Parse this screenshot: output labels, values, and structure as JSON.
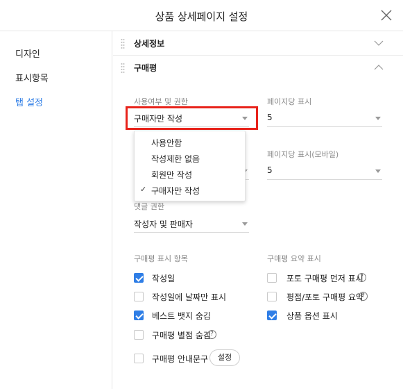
{
  "dialog": {
    "title": "상품 상세페이지 설정"
  },
  "sidebar": {
    "items": [
      {
        "label": "디자인",
        "active": false
      },
      {
        "label": "표시항목",
        "active": false
      },
      {
        "label": "탭 설정",
        "active": true
      }
    ]
  },
  "sections": {
    "detail": {
      "title": "상세정보"
    },
    "review": {
      "title": "구매평"
    }
  },
  "review_settings": {
    "usage_label": "사용여부 및 권한",
    "usage_value": "구매자만 작성",
    "per_page_label": "페이지당 표시",
    "per_page_value": "5",
    "per_page_mobile_label": "페이지당 표시(모바일)",
    "per_page_mobile_value": "5",
    "comment_label": "댓글 권한",
    "comment_value": "작성자 및 판매자"
  },
  "usage_dropdown": {
    "options": [
      "사용안함",
      "작성제한 없음",
      "회원만 작성",
      "구매자만 작성"
    ],
    "selected": "구매자만 작성",
    "check_glyph": "✓"
  },
  "display_items": {
    "label": "구매평 표시 항목",
    "items": [
      {
        "label": "작성일",
        "checked": true
      },
      {
        "label": "작성일에 날짜만 표시",
        "checked": false
      },
      {
        "label": "베스트 뱃지 숨김",
        "checked": true
      },
      {
        "label": "구매평 별점 숨김",
        "checked": false
      },
      {
        "label": "구매평 안내문구",
        "checked": false
      }
    ],
    "settings_button": "설정"
  },
  "summary_items": {
    "label": "구매평 요약 표시",
    "items": [
      {
        "label": "포토 구매평 먼저 표시",
        "checked": false
      },
      {
        "label": "평점/포토 구매평 요약",
        "checked": false
      },
      {
        "label": "상품 옵션 표시",
        "checked": true
      }
    ]
  },
  "help_glyph": "?",
  "colors": {
    "accent": "#2f7ee6",
    "highlight": "#e8231b"
  }
}
